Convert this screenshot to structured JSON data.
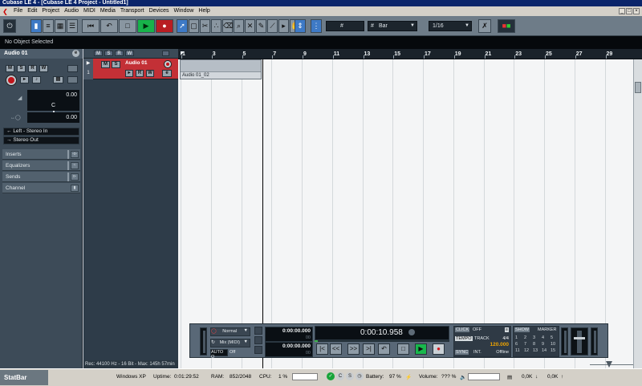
{
  "window": {
    "title": "Cubase LE 4 - [Cubase LE 4 Project - Untitled1]"
  },
  "menu": {
    "items": [
      {
        "id": "file",
        "label": "File"
      },
      {
        "id": "edit",
        "label": "Edit"
      },
      {
        "id": "project",
        "label": "Project"
      },
      {
        "id": "audio",
        "label": "Audio"
      },
      {
        "id": "midi",
        "label": "MIDI"
      },
      {
        "id": "media",
        "label": "Media"
      },
      {
        "id": "transport",
        "label": "Transport"
      },
      {
        "id": "devices",
        "label": "Devices"
      },
      {
        "id": "window",
        "label": "Window"
      },
      {
        "id": "help",
        "label": "Help"
      }
    ]
  },
  "toolbar": {
    "snap_grid": "Bar",
    "quantize": "1/16",
    "tools": [
      "object-selection",
      "range-selection",
      "split",
      "glue",
      "erase",
      "zoom",
      "mute",
      "draw",
      "line",
      "play",
      "color"
    ]
  },
  "infoline": {
    "text": "No Object Selected"
  },
  "inspector": {
    "track_name": "Audio 01",
    "volume": "0.00",
    "pan": "C",
    "send": "0.00",
    "input_routing": "Left - Stereo In",
    "output_routing": "Stereo Out",
    "sections": [
      {
        "id": "inserts",
        "label": "Inserts"
      },
      {
        "id": "equalizers",
        "label": "Equalizers"
      },
      {
        "id": "sends",
        "label": "Sends"
      },
      {
        "id": "channel",
        "label": "Channel"
      }
    ]
  },
  "tracklist": {
    "tracks": [
      {
        "number": "1",
        "name": "Audio 01"
      }
    ],
    "status": "Rec: 44100 Hz - 16 Bit - Max: 145h 57min"
  },
  "ruler": {
    "bars": [
      "1",
      "3",
      "5",
      "7",
      "9",
      "11",
      "13",
      "15",
      "17",
      "19",
      "21",
      "23",
      "25",
      "27",
      "29"
    ]
  },
  "event": {
    "name": "Audio 01_02"
  },
  "transport": {
    "record_mode": "Normal",
    "cycle_mode": "Mix (MIDI)",
    "auto_q": "AUTO Q",
    "auto_q_value": "Off",
    "left_locator": "0:00:00.000",
    "right_locator": "0:00:00.000",
    "left_locator_sub": "00",
    "right_locator_sub": "00",
    "primary_time": "0:00:10.958",
    "click_label": "CLICK",
    "click_value": "OFF",
    "tempo_label": "TEMPO",
    "tempo_mode": "TRACK",
    "signature": "4/4",
    "tempo": "120.000",
    "sync_label": "SYNC",
    "sync_source": "INT.",
    "sync_state": "Offline",
    "show_label": "SHOW",
    "marker_label": "MARKER",
    "marker_numbers": [
      "1",
      "2",
      "3",
      "4",
      "5",
      "6",
      "7",
      "8",
      "9",
      "10",
      "11",
      "12",
      "13",
      "14",
      "15"
    ]
  },
  "statbar": {
    "title": "StatBar",
    "os": "Windows XP",
    "uptime_label": "Uptime:",
    "uptime": "0:01:29:52",
    "ram_label": "RAM:",
    "ram": "852/2048",
    "cpu_label": "CPU:",
    "cpu": "1 %",
    "battery_label": "Battery:",
    "battery": "97 %",
    "volume_label": "Volume:",
    "volume": "??? %",
    "net_down": "0,0K",
    "net_up": "0,0K"
  }
}
